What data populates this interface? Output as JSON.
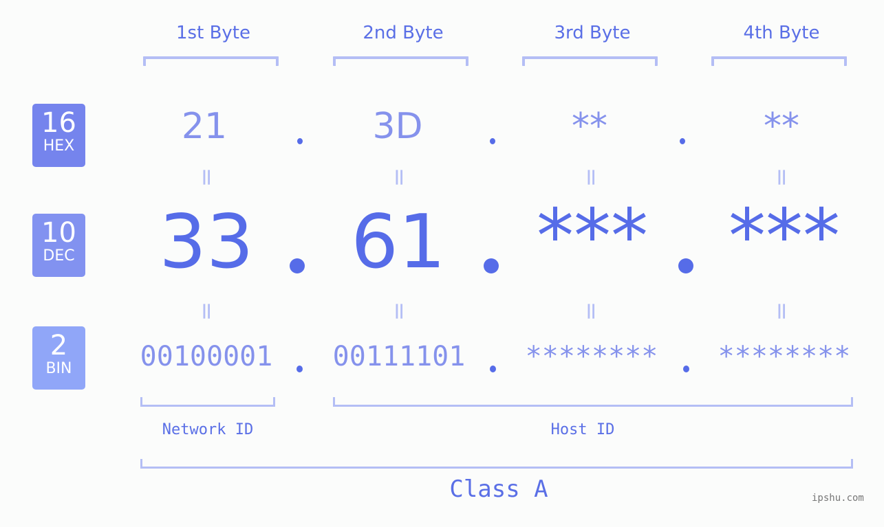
{
  "bytes": [
    {
      "header": "1st Byte",
      "hex": "21",
      "dec": "33",
      "bin": "00100001"
    },
    {
      "header": "2nd Byte",
      "hex": "3D",
      "dec": "61",
      "bin": "00111101"
    },
    {
      "header": "3rd Byte",
      "hex": "**",
      "dec": "***",
      "bin": "********"
    },
    {
      "header": "4th Byte",
      "hex": "**",
      "dec": "***",
      "bin": "********"
    }
  ],
  "badges": {
    "hex": {
      "number": "16",
      "label": "HEX",
      "color": "#7584ed"
    },
    "dec": {
      "number": "10",
      "label": "DEC",
      "color": "#8292f0"
    },
    "bin": {
      "number": "2",
      "label": "BIN",
      "color": "#90a6f8"
    }
  },
  "equals_symbol": "=",
  "network_id_label": "Network ID",
  "host_id_label": "Host ID",
  "class_label": "Class A",
  "watermark": "ipshu.com",
  "colors": {
    "accent": "#566ce8",
    "light_accent": "#8592ec",
    "bracket": "#b4bef5",
    "background": "#fbfcfb"
  }
}
